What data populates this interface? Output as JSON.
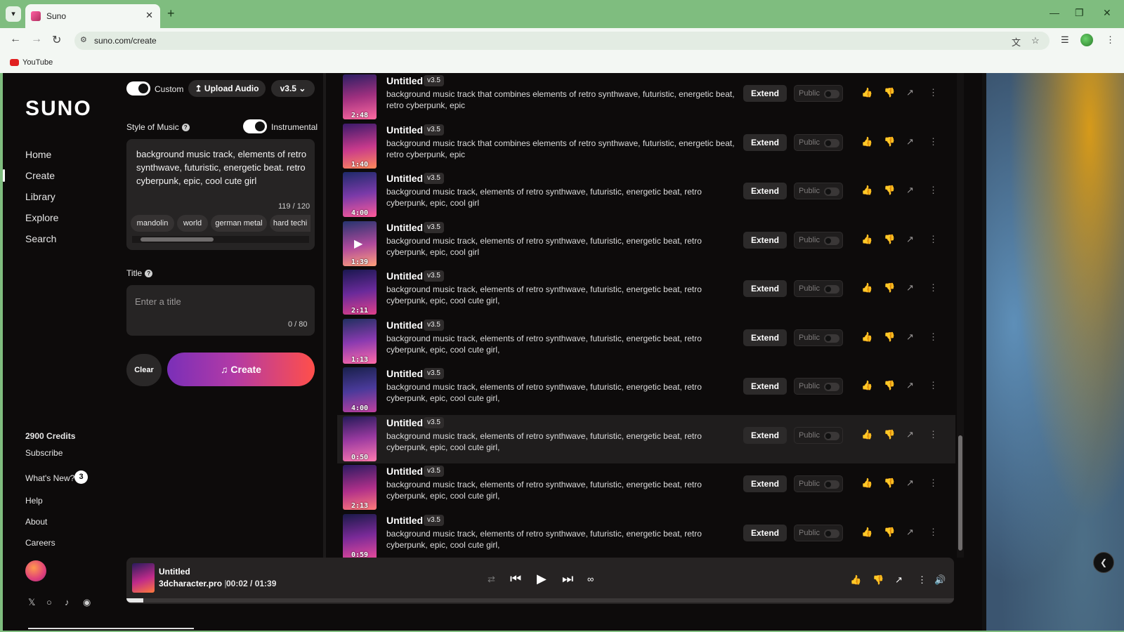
{
  "browser": {
    "tab_title": "Suno",
    "url": "suno.com/create",
    "bookmark": "YouTube"
  },
  "sidebar": {
    "logo": "SUNO",
    "nav": [
      "Home",
      "Create",
      "Library",
      "Explore",
      "Search"
    ],
    "credits": "2900 Credits",
    "subscribe": "Subscribe",
    "whats_new": "What's New?",
    "whats_new_count": "3",
    "help": "Help",
    "about": "About",
    "careers": "Careers"
  },
  "create": {
    "custom_label": "Custom",
    "upload_label": "Upload Audio",
    "version": "v3.5",
    "style_label": "Style of Music",
    "instrumental_label": "Instrumental",
    "style_text": "background music track, elements of retro synthwave, futuristic, energetic beat. retro cyberpunk, epic, cool cute girl",
    "style_counter": "119 / 120",
    "tags": [
      "mandolin",
      "world",
      "german metal",
      "hard techi"
    ],
    "title_label": "Title",
    "title_placeholder": "Enter a title",
    "title_counter": "0 / 80",
    "clear_label": "Clear",
    "create_label": "Create"
  },
  "songs": [
    {
      "title": "Untitled",
      "version": "v3.5",
      "duration": "2:48",
      "desc": "background music track that combines elements of retro synthwave, futuristic, energetic beat, retro cyberpunk, epic"
    },
    {
      "title": "Untitled",
      "version": "v3.5",
      "duration": "1:40",
      "desc": "background music track that combines elements of retro synthwave, futuristic, energetic beat, retro cyberpunk, epic"
    },
    {
      "title": "Untitled",
      "version": "v3.5",
      "duration": "4:00",
      "desc": "background music track, elements of retro synthwave, futuristic, energetic beat, retro cyberpunk, epic, cool girl"
    },
    {
      "title": "Untitled",
      "version": "v3.5",
      "duration": "1:39",
      "desc": "background music track, elements of retro synthwave, futuristic, energetic beat, retro cyberpunk, epic, cool girl"
    },
    {
      "title": "Untitled",
      "version": "v3.5",
      "duration": "2:11",
      "desc": "background music track, elements of retro synthwave, futuristic, energetic beat, retro cyberpunk, epic, cool cute girl,"
    },
    {
      "title": "Untitled",
      "version": "v3.5",
      "duration": "1:13",
      "desc": "background music track, elements of retro synthwave, futuristic, energetic beat, retro cyberpunk, epic, cool cute girl,"
    },
    {
      "title": "Untitled",
      "version": "v3.5",
      "duration": "4:00",
      "desc": "background music track, elements of retro synthwave, futuristic, energetic beat, retro cyberpunk, epic, cool cute girl,"
    },
    {
      "title": "Untitled",
      "version": "v3.5",
      "duration": "0:50",
      "desc": "background music track, elements of retro synthwave, futuristic, energetic beat, retro cyberpunk, epic, cool cute girl,"
    },
    {
      "title": "Untitled",
      "version": "v3.5",
      "duration": "2:13",
      "desc": "background music track, elements of retro synthwave, futuristic, energetic beat, retro cyberpunk, epic, cool cute girl,"
    },
    {
      "title": "Untitled",
      "version": "v3.5",
      "duration": "0:59",
      "desc": "background music track, elements of retro synthwave, futuristic, energetic beat, retro cyberpunk, epic, cool cute girl,"
    }
  ],
  "song_actions": {
    "extend": "Extend",
    "public": "Public"
  },
  "player": {
    "title": "Untitled",
    "artist": "3dcharacter.pro",
    "time": "00:02 / 01:39",
    "progress": 0.02
  },
  "colors": {
    "accent_start": "#7a2fb8",
    "accent_end": "#ff4f4a",
    "browser_frame": "#7fbd7f"
  }
}
